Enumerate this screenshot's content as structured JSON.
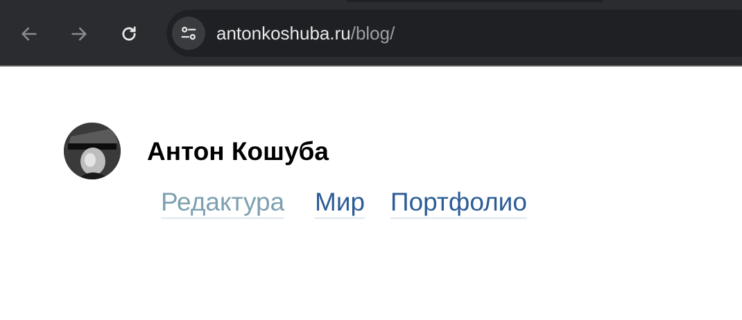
{
  "browser": {
    "url_host": "antonkoshuba.ru",
    "url_path": "/blog/",
    "icons": {
      "back": "arrow-left-icon",
      "forward": "arrow-right-icon",
      "reload": "reload-icon",
      "site_info": "tune-icon"
    }
  },
  "header": {
    "author_name": "Антон Кошуба",
    "avatar": "avatar-photo"
  },
  "nav": {
    "items": [
      {
        "label": "Редактура",
        "color": "#7da0b1"
      },
      {
        "label": "Мир",
        "color": "#2c5c96"
      },
      {
        "label": "Портфолио",
        "color": "#2c5c96"
      }
    ]
  }
}
